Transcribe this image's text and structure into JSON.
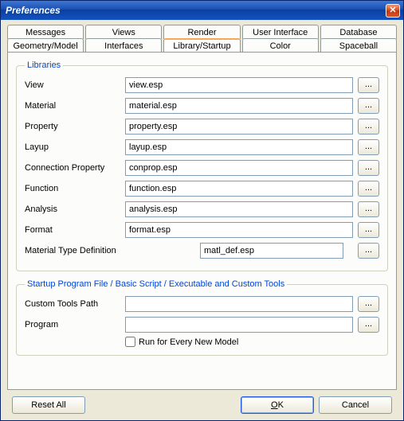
{
  "window": {
    "title": "Preferences"
  },
  "tabs_row1": [
    "Messages",
    "Views",
    "Render",
    "User Interface",
    "Database"
  ],
  "tabs_row2": [
    "Geometry/Model",
    "Interfaces",
    "Library/Startup",
    "Color",
    "Spaceball"
  ],
  "active_tab": "Library/Startup",
  "group_libraries": {
    "legend": "Libraries",
    "rows": [
      {
        "label": "View",
        "value": "view.esp"
      },
      {
        "label": "Material",
        "value": "material.esp"
      },
      {
        "label": "Property",
        "value": "property.esp"
      },
      {
        "label": "Layup",
        "value": "layup.esp"
      },
      {
        "label": "Connection Property",
        "value": "conprop.esp"
      },
      {
        "label": "Function",
        "value": "function.esp"
      },
      {
        "label": "Analysis",
        "value": "analysis.esp"
      },
      {
        "label": "Format",
        "value": "format.esp"
      }
    ],
    "mtd_label": "Material Type Definition",
    "mtd_value": "matl_def.esp",
    "browse": "..."
  },
  "group_startup": {
    "legend": "Startup Program File / Basic Script / Executable and Custom Tools",
    "custom_label": "Custom Tools Path",
    "custom_value": "",
    "program_label": "Program",
    "program_value": "",
    "run_checkbox_label": "Run for Every New Model",
    "run_checked": false,
    "browse": "..."
  },
  "buttons": {
    "reset": "Reset All",
    "ok": "OK",
    "cancel": "Cancel"
  }
}
